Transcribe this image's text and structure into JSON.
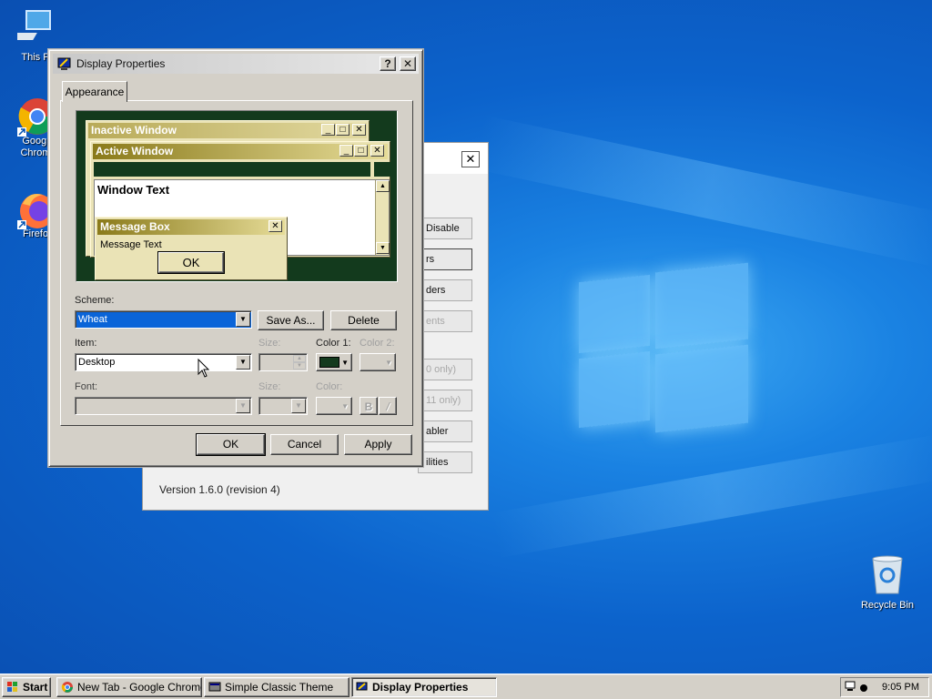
{
  "desktop": {
    "icons": [
      {
        "label": "This P"
      },
      {
        "label": "Googl\nChrom"
      },
      {
        "label": "Firefo"
      },
      {
        "label": "Recycle Bin"
      }
    ]
  },
  "background_window": {
    "buttons": [
      "Disable",
      "rs",
      "ders",
      "ents",
      "0 only)",
      "11 only)",
      "abler",
      "ilities"
    ],
    "version": "Version 1.6.0 (revision 4)"
  },
  "dialog": {
    "title": "Display Properties",
    "help_glyph": "?",
    "close_glyph": "✕",
    "tab": "Appearance",
    "preview": {
      "inactive_title": "Inactive Window",
      "active_title": "Active Window",
      "window_text": "Window Text",
      "msgbox_title": "Message Box",
      "msgbox_text": "Message Text",
      "ok": "OK"
    },
    "scheme_label": "Scheme:",
    "scheme_value": "Wheat",
    "save_as": "Save As...",
    "delete": "Delete",
    "item_label": "Item:",
    "item_value": "Desktop",
    "size_label": "Size:",
    "color1_label": "Color 1:",
    "color2_label": "Color 2:",
    "font_label": "Font:",
    "font_size_label": "Size:",
    "font_color_label": "Color:",
    "bold": "B",
    "italic": "/",
    "ok": "OK",
    "cancel": "Cancel",
    "apply": "Apply"
  },
  "colors": {
    "desktop_preview": "#133a1d",
    "title_gold_dark": "#8a7a1a",
    "title_gold_light": "#e6dc98",
    "selection": "#0a64d8",
    "color1_swatch": "#133a1d"
  },
  "taskbar": {
    "start": "Start",
    "items": [
      "New Tab - Google Chrome",
      "Simple Classic Theme",
      "Display Properties"
    ],
    "clock": "9:05 PM"
  }
}
